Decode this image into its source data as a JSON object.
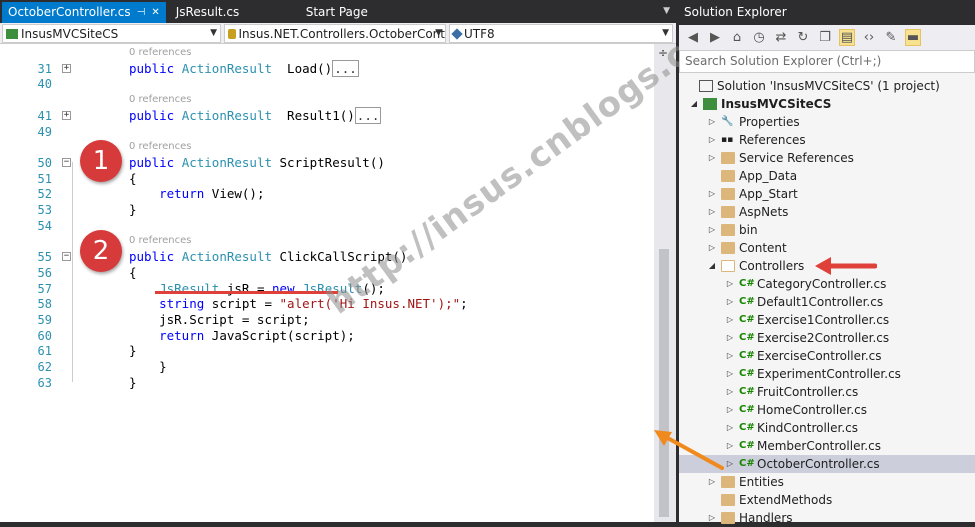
{
  "tabs": {
    "active": "OctoberController.cs",
    "pin": "⊣",
    "close": "✕",
    "others": [
      "JsResult.cs",
      "Start Page"
    ],
    "dropdown": "▼"
  },
  "navbar": {
    "project": "InsusMVCSiteCS",
    "namespace": "Insus.NET.Controllers.OctoberCont",
    "encoding": "UTF8"
  },
  "code": {
    "lines": [
      {
        "refs": "0 references"
      },
      {
        "num": "31",
        "glyph": "+",
        "tokens": [
          [
            "kw",
            "public "
          ],
          [
            "ty",
            "ActionResult"
          ],
          [
            "",
            "  Load()"
          ],
          [
            "coll",
            "..."
          ]
        ]
      },
      {
        "num": "40"
      },
      {
        "refs": "0 references"
      },
      {
        "num": "41",
        "glyph": "+",
        "tokens": [
          [
            "kw",
            "public "
          ],
          [
            "ty",
            "ActionResult"
          ],
          [
            "",
            "  Result1()"
          ],
          [
            "coll",
            "..."
          ]
        ]
      },
      {
        "num": "49"
      },
      {
        "refs": "0 references"
      },
      {
        "num": "50",
        "glyph": "−",
        "tokens": [
          [
            "kw",
            "public "
          ],
          [
            "ty",
            "ActionResult"
          ],
          [
            "",
            " ScriptResult()"
          ]
        ]
      },
      {
        "num": "51",
        "tokens": [
          [
            "",
            "{"
          ]
        ]
      },
      {
        "num": "52",
        "tokens": [
          [
            "",
            "    "
          ],
          [
            "kw",
            "return "
          ],
          [
            "",
            "View();"
          ]
        ]
      },
      {
        "num": "53",
        "tokens": [
          [
            "",
            "}"
          ]
        ]
      },
      {
        "num": "54"
      },
      {
        "refs": "0 references"
      },
      {
        "num": "55",
        "glyph": "−",
        "tokens": [
          [
            "kw",
            "public "
          ],
          [
            "ty",
            "ActionResult"
          ],
          [
            "",
            " ClickCallScript()"
          ]
        ]
      },
      {
        "num": "56",
        "tokens": [
          [
            "",
            "{"
          ]
        ]
      },
      {
        "num": "57",
        "tokens": [
          [
            "",
            "    "
          ],
          [
            "ty",
            "JsResult"
          ],
          [
            "",
            " jsR = "
          ],
          [
            "kw",
            "new "
          ],
          [
            "ty",
            "JsResult"
          ],
          [
            "",
            "();"
          ]
        ]
      },
      {
        "num": "58",
        "tokens": [
          [
            "",
            "    "
          ],
          [
            "kw",
            "string "
          ],
          [
            "",
            "script = "
          ],
          [
            "st",
            "\"alert('Hi Insus.NET');\""
          ],
          [
            "",
            ";"
          ]
        ]
      },
      {
        "num": "59",
        "tokens": [
          [
            "",
            "    jsR.Script = script;"
          ]
        ]
      },
      {
        "num": "60",
        "tokens": [
          [
            "",
            "    "
          ],
          [
            "kw",
            "return "
          ],
          [
            "",
            "JavaScript(script);"
          ]
        ]
      },
      {
        "num": "61",
        "tokens": [
          [
            "",
            "}"
          ]
        ]
      },
      {
        "num": "62",
        "tokens": [
          [
            "",
            "    }"
          ]
        ]
      },
      {
        "num": "63",
        "tokens": [
          [
            "",
            "}"
          ]
        ]
      }
    ]
  },
  "badges": [
    "1",
    "2"
  ],
  "watermark": "http://insus.cnblogs.com",
  "solution_explorer": {
    "title": "Solution Explorer",
    "search_placeholder": "Search Solution Explorer (Ctrl+;)",
    "nodes": [
      {
        "label": "Solution 'InsusMVCSiteCS' (1 project)",
        "level": 0,
        "icon": "solution-icon",
        "exp": ""
      },
      {
        "label": "InsusMVCSiteCS",
        "level": 1,
        "icon": "project-icon",
        "exp": "◢",
        "bold": true
      },
      {
        "label": "Properties",
        "level": 2,
        "icon": "wrench-icon",
        "exp": "▷"
      },
      {
        "label": "References",
        "level": 2,
        "icon": "references-icon",
        "exp": "▷"
      },
      {
        "label": "Service References",
        "level": 2,
        "icon": "folder-icon",
        "exp": "▷"
      },
      {
        "label": "App_Data",
        "level": 2,
        "icon": "folder-icon",
        "exp": ""
      },
      {
        "label": "App_Start",
        "level": 2,
        "icon": "folder-icon",
        "exp": "▷"
      },
      {
        "label": "AspNets",
        "level": 2,
        "icon": "folder-icon",
        "exp": "▷"
      },
      {
        "label": "bin",
        "level": 2,
        "icon": "folder-icon",
        "exp": "▷"
      },
      {
        "label": "Content",
        "level": 2,
        "icon": "folder-icon",
        "exp": "▷"
      },
      {
        "label": "Controllers",
        "level": 2,
        "icon": "folder-open-icon",
        "exp": "◢"
      },
      {
        "label": "CategoryController.cs",
        "level": 3,
        "icon": "csharp-file-icon",
        "exp": "▷"
      },
      {
        "label": "Default1Controller.cs",
        "level": 3,
        "icon": "csharp-file-icon",
        "exp": "▷"
      },
      {
        "label": "Exercise1Controller.cs",
        "level": 3,
        "icon": "csharp-file-icon",
        "exp": "▷"
      },
      {
        "label": "Exercise2Controller.cs",
        "level": 3,
        "icon": "csharp-file-icon",
        "exp": "▷"
      },
      {
        "label": "ExerciseController.cs",
        "level": 3,
        "icon": "csharp-file-icon",
        "exp": "▷"
      },
      {
        "label": "ExperimentController.cs",
        "level": 3,
        "icon": "csharp-file-icon",
        "exp": "▷"
      },
      {
        "label": "FruitController.cs",
        "level": 3,
        "icon": "csharp-file-icon",
        "exp": "▷"
      },
      {
        "label": "HomeController.cs",
        "level": 3,
        "icon": "csharp-file-icon",
        "exp": "▷"
      },
      {
        "label": "KindController.cs",
        "level": 3,
        "icon": "csharp-file-icon",
        "exp": "▷"
      },
      {
        "label": "MemberController.cs",
        "level": 3,
        "icon": "csharp-file-icon",
        "exp": "▷"
      },
      {
        "label": "OctoberController.cs",
        "level": 3,
        "icon": "csharp-file-icon",
        "exp": "▷",
        "selected": true
      },
      {
        "label": "Entities",
        "level": 2,
        "icon": "folder-icon",
        "exp": "▷"
      },
      {
        "label": "ExtendMethods",
        "level": 2,
        "icon": "folder-icon",
        "exp": ""
      },
      {
        "label": "Handlers",
        "level": 2,
        "icon": "folder-icon",
        "exp": "▷"
      }
    ]
  },
  "colors": {
    "accent": "#007acc",
    "annotation_red": "#e0403a",
    "annotation_orange": "#f08a1c",
    "badge": "#d63a3a"
  }
}
